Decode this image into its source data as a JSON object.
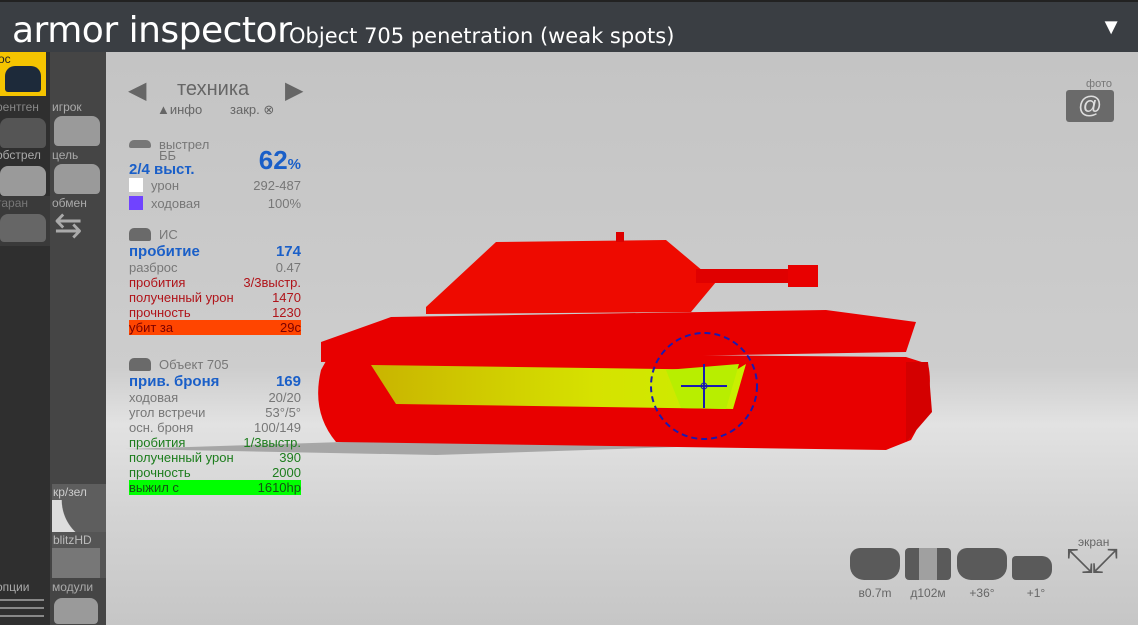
{
  "header": {
    "app_title": "armor inspector",
    "subtitle": "Object 705 penetration (weak spots)",
    "menu_icon": "▼"
  },
  "sidebar": {
    "col1": [
      {
        "label": "ос",
        "active": true
      },
      {
        "label": "рентген"
      },
      {
        "label": "обстрел"
      },
      {
        "label": "таран"
      },
      {
        "label": "опции"
      }
    ],
    "col2": [
      {
        "label": "игрок"
      },
      {
        "label": "цель"
      },
      {
        "label": "обмен"
      },
      {
        "label": "кр/зел"
      },
      {
        "label": "blitzHD"
      },
      {
        "label": "модули"
      }
    ]
  },
  "nav": {
    "prev": "◀",
    "title": "техника",
    "next": "▶",
    "info": "▲инфо",
    "close": "закр.",
    "close_icon": "⊗"
  },
  "shot": {
    "header": "выстрел",
    "ammo": "ББ",
    "shots": "2/4 выст.",
    "percent": "62",
    "percent_sign": "%",
    "damage_label": "урон",
    "damage": "292-487",
    "tracks_label": "ходовая",
    "tracks": "100%",
    "damage_color": "#ffffff",
    "tracks_color": "#7043ff"
  },
  "attacker": {
    "name": "ИС",
    "pen_label": "пробитие",
    "pen": "174",
    "spread_label": "разброс",
    "spread": "0.47",
    "hits_label": "пробития",
    "hits": "3/3выстр.",
    "dmg_label": "полученный урон",
    "dmg": "1470",
    "hp_label": "прочность",
    "hp": "1230",
    "result_label": "убит за",
    "result": "29с",
    "result_color": "#ff4500"
  },
  "target": {
    "name": "Объект 705",
    "armor_label": "прив. броня",
    "armor": "169",
    "tracks_label": "ходовая",
    "tracks": "20/20",
    "angle_label": "угол встречи",
    "angle": "53°/5°",
    "base_label": "осн. броня",
    "base": "100/149",
    "hits_label": "пробития",
    "hits": "1/3выстр.",
    "dmg_label": "полученный урон",
    "dmg": "390",
    "hp_label": "прочность",
    "hp": "2000",
    "result_label": "выжил с",
    "result": "1610hp",
    "result_color": "#00ff00"
  },
  "photo": {
    "label": "фото",
    "icon": "@"
  },
  "controls": {
    "screen_label": "экран",
    "height": "в0.7m",
    "distance": "д102м",
    "turret": "+36°",
    "gun": "+1°"
  }
}
